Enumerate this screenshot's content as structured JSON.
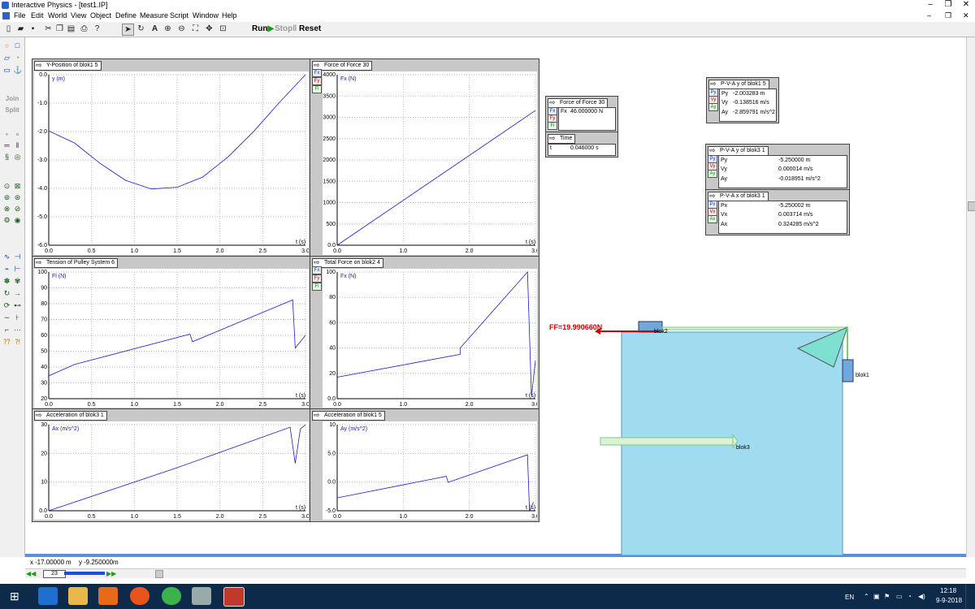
{
  "window": {
    "title": "Interactive Physics - [test1.IP]"
  },
  "menu": [
    "File",
    "Edit",
    "World",
    "View",
    "Object",
    "Define",
    "Measure",
    "Script",
    "Window",
    "Help"
  ],
  "toolbar": {
    "run": "Run",
    "stop": "Stop",
    "reset": "Reset"
  },
  "left_tools": {
    "join": "Join",
    "split": "Split"
  },
  "graphs": [
    {
      "title": "Y-Position of blok1 5",
      "unit": "y (m)",
      "xlabel": "t (s)",
      "yticks": [
        "0.0",
        "-1.0",
        "-2.0",
        "-3.0",
        "-4.0",
        "-5.0",
        "-6.0"
      ],
      "xticks": [
        "0.0",
        "0.5",
        "1.0",
        "1.5",
        "2.0",
        "2.5",
        "3.0"
      ]
    },
    {
      "title": "Force of Force 30",
      "unit": "Fx (N)",
      "xlabel": "t (s)",
      "yticks": [
        "4000",
        "3500",
        "3000",
        "2500",
        "2000",
        "1500",
        "1000",
        "500",
        "0.0"
      ],
      "xticks": [
        "0.0",
        "1.0",
        "2.0",
        "3.0"
      ]
    },
    {
      "title": "Tension of Pulley System 6",
      "unit": "Fl (N)",
      "xlabel": "t (s)",
      "yticks": [
        "100",
        "90",
        "80",
        "70",
        "60",
        "50",
        "40",
        "30",
        "20"
      ],
      "xticks": [
        "0.0",
        "0.5",
        "1.0",
        "1.5",
        "2.0",
        "2.5",
        "3.0"
      ]
    },
    {
      "title": "Total Force on blok2 4",
      "unit": "Fx (N)",
      "xlabel": "t (s)",
      "yticks": [
        "100",
        "80",
        "60",
        "40",
        "20",
        "0.0"
      ],
      "xticks": [
        "0.0",
        "1.0",
        "2.0",
        "3.0"
      ]
    },
    {
      "title": "Acceleration of blok3 1",
      "unit": "Ax (m/s^2)",
      "xlabel": "t (s)",
      "yticks": [
        "30",
        "20",
        "10",
        "0.0"
      ],
      "xticks": [
        "0.0",
        "0.5",
        "1.0",
        "1.5",
        "2.0",
        "2.5",
        "3.0"
      ]
    },
    {
      "title": "Acceleration of blok1 5",
      "unit": "Ay (m/s^2)",
      "xlabel": "t (s)",
      "yticks": [
        "10",
        "5.0",
        "0.0",
        "-5.0"
      ],
      "xticks": [
        "0.0",
        "1.0",
        "2.0",
        "3.0"
      ]
    }
  ],
  "graph_buttons": {
    "fx": "Fx",
    "fy": "Fy",
    "fl": "Fl",
    "px": "Px",
    "py": "Py",
    "vx": "Vx",
    "vy": "Vy",
    "ax": "Ax",
    "ay": "Ay"
  },
  "digital_meters": {
    "force30": {
      "title": "Force of Force 30",
      "label": "Fx",
      "value": "46.000000 N"
    },
    "time": {
      "title": "Time",
      "label": "t",
      "value": "0.046000 s"
    },
    "pva_y_blok1": {
      "title": "P-V-A y of blok1 5",
      "rows": [
        {
          "label": "Py",
          "value": "-2.003283 m"
        },
        {
          "label": "Vy",
          "value": "-0.138516 m/s"
        },
        {
          "label": "Ay",
          "value": "-2.859791 m/s^2"
        }
      ]
    },
    "pva_y_blok3": {
      "title": "P-V-A y of blok3 1",
      "rows": [
        {
          "label": "Py",
          "value": "-5.250000 m"
        },
        {
          "label": "Vy",
          "value": "0.000014 m/s"
        },
        {
          "label": "Ay",
          "value": "-0.018951 m/s^2"
        }
      ]
    },
    "pva_x_blok3": {
      "title": "P-V-A x of blok3 1",
      "rows": [
        {
          "label": "Px",
          "value": "-5.250002 m"
        },
        {
          "label": "Vx",
          "value": "0.003714 m/s"
        },
        {
          "label": "Ax",
          "value": "0.324285 m/s^2"
        }
      ]
    }
  },
  "scene": {
    "friction_label": "FF=19.990660N",
    "blok1": "blok1",
    "blok2": "blok2",
    "blok3": "blok3",
    "colors": {
      "table": "#9fdcef",
      "friction": "#cc0000",
      "pulley": "#7ee0d0"
    }
  },
  "status": {
    "x": "-17.00000",
    "x_unit": "m",
    "y": "-9.250000",
    "y_unit": "m",
    "frame": "23"
  },
  "taskbar": {
    "lang": "EN",
    "time": "12:18",
    "date": "9-9-2018"
  }
}
